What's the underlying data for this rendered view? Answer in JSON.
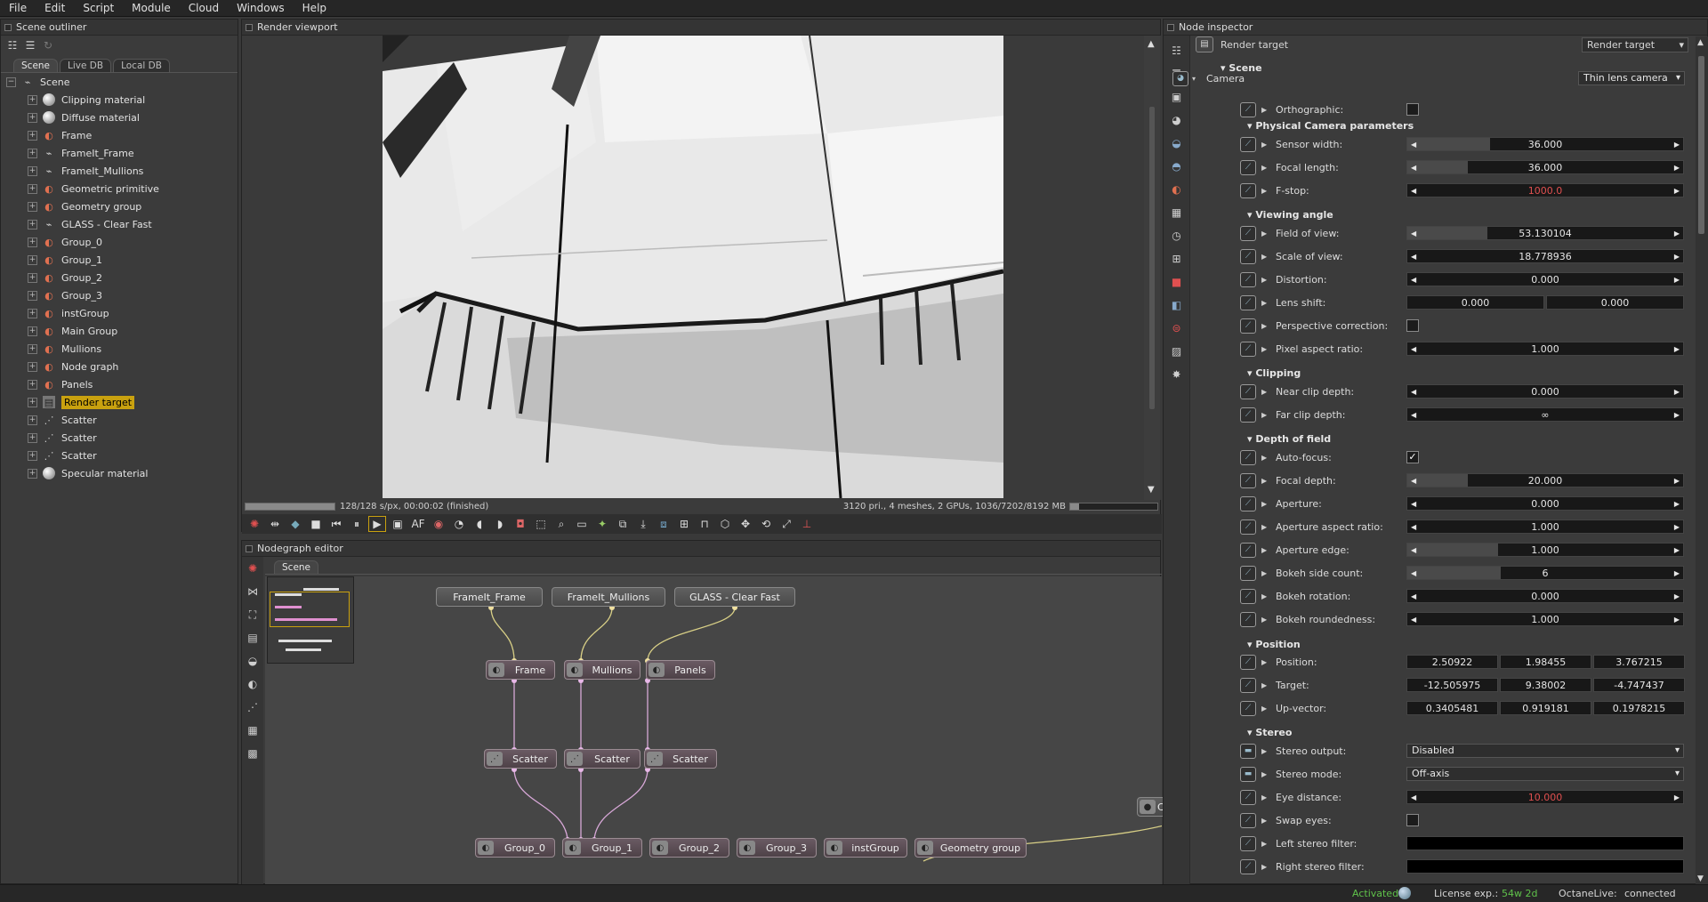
{
  "menu": [
    "File",
    "Edit",
    "Script",
    "Module",
    "Cloud",
    "Windows",
    "Help"
  ],
  "outliner": {
    "title": "Scene outliner",
    "tabs": [
      "Scene",
      "Live DB",
      "Local DB"
    ],
    "root": "Scene",
    "items": [
      {
        "label": "Clipping material",
        "icon": "material-sphere-icon"
      },
      {
        "label": "Diffuse material",
        "icon": "material-sphere-icon"
      },
      {
        "label": "Frame",
        "icon": "geometry-icon"
      },
      {
        "label": "FrameIt_Frame",
        "icon": "mesh-icon"
      },
      {
        "label": "FrameIt_Mullions",
        "icon": "mesh-icon"
      },
      {
        "label": "Geometric primitive",
        "icon": "geometry-icon"
      },
      {
        "label": "Geometry group",
        "icon": "geometry-icon"
      },
      {
        "label": "GLASS - Clear Fast",
        "icon": "mesh-icon"
      },
      {
        "label": "Group_0",
        "icon": "geometry-icon"
      },
      {
        "label": "Group_1",
        "icon": "geometry-icon"
      },
      {
        "label": "Group_2",
        "icon": "geometry-icon"
      },
      {
        "label": "Group_3",
        "icon": "geometry-icon"
      },
      {
        "label": "instGroup",
        "icon": "geometry-icon"
      },
      {
        "label": "Main Group",
        "icon": "geometry-icon"
      },
      {
        "label": "Mullions",
        "icon": "geometry-icon"
      },
      {
        "label": "Node graph",
        "icon": "geometry-icon"
      },
      {
        "label": "Panels",
        "icon": "geometry-icon"
      },
      {
        "label": "Render target",
        "icon": "render-target-icon"
      },
      {
        "label": "Scatter",
        "icon": "scatter-icon"
      },
      {
        "label": "Scatter",
        "icon": "scatter-icon"
      },
      {
        "label": "Scatter",
        "icon": "scatter-icon"
      },
      {
        "label": "Specular material",
        "icon": "material-sphere-icon"
      }
    ]
  },
  "viewport": {
    "title": "Render viewport",
    "progress": 1.0,
    "status_left": "128/128 s/px, 00:00:02 (finished)",
    "status_right": "3120 pri., 4 meshes, 2 GPUs, 1036/7202/8192 MB"
  },
  "nodegraph": {
    "title": "Nodegraph editor",
    "tab": "Scene",
    "nodes": {
      "frameit_frame": "FrameIt_Frame",
      "frameit_mullions": "FrameIt_Mullions",
      "glass": "GLASS - Clear Fast",
      "frame": "Frame",
      "mullions": "Mullions",
      "panels": "Panels",
      "scatter1": "Scatter",
      "scatter2": "Scatter",
      "scatter3": "Scatter",
      "group0": "Group_0",
      "group1": "Group_1",
      "group2": "Group_2",
      "group3": "Group_3",
      "instgroup": "instGroup",
      "geomgroup": "Geometry group",
      "clipping": "Clipping mate"
    }
  },
  "inspector": {
    "title": "Node inspector",
    "node_name": "Render target",
    "node_type": "Render target",
    "scene": "Scene",
    "camera": "Camera",
    "camera_type": "Thin lens camera",
    "orthographic": "Orthographic:",
    "sec_physical": "Physical Camera parameters",
    "sensor_width": {
      "label": "Sensor width:",
      "value": "36.000"
    },
    "focal_length": {
      "label": "Focal length:",
      "value": "36.000"
    },
    "fstop": {
      "label": "F-stop:",
      "value": "1000.0"
    },
    "sec_view": "Viewing angle",
    "fov": {
      "label": "Field of view:",
      "value": "53.130104"
    },
    "scale_view": {
      "label": "Scale of view:",
      "value": "18.778936"
    },
    "distortion": {
      "label": "Distortion:",
      "value": "0.000"
    },
    "lens_shift": {
      "label": "Lens shift:",
      "v1": "0.000",
      "v2": "0.000"
    },
    "persp_corr": "Perspective correction:",
    "pixel_aspect": {
      "label": "Pixel aspect ratio:",
      "value": "1.000"
    },
    "sec_clip": "Clipping",
    "near_clip": {
      "label": "Near clip depth:",
      "value": "0.000"
    },
    "far_clip": {
      "label": "Far clip depth:",
      "value": "∞"
    },
    "sec_dof": "Depth of field",
    "autofocus": "Auto-focus:",
    "focal_depth": {
      "label": "Focal depth:",
      "value": "20.000"
    },
    "aperture": {
      "label": "Aperture:",
      "value": "0.000"
    },
    "aperture_aspect": {
      "label": "Aperture aspect ratio:",
      "value": "1.000"
    },
    "aperture_edge": {
      "label": "Aperture edge:",
      "value": "1.000"
    },
    "bokeh_side": {
      "label": "Bokeh side count:",
      "value": "6"
    },
    "bokeh_rot": {
      "label": "Bokeh rotation:",
      "value": "0.000"
    },
    "bokeh_round": {
      "label": "Bokeh roundedness:",
      "value": "1.000"
    },
    "sec_pos": "Position",
    "position": {
      "label": "Position:",
      "v1": "2.50922",
      "v2": "1.98455",
      "v3": "3.767215"
    },
    "target": {
      "label": "Target:",
      "v1": "-12.505975",
      "v2": "9.38002",
      "v3": "-4.747437"
    },
    "upvector": {
      "label": "Up-vector:",
      "v1": "0.3405481",
      "v2": "0.919181",
      "v3": "0.1978215"
    },
    "sec_stereo": "Stereo",
    "stereo_output": {
      "label": "Stereo output:",
      "value": "Disabled"
    },
    "stereo_mode": {
      "label": "Stereo mode:",
      "value": "Off-axis"
    },
    "eye_distance": {
      "label": "Eye distance:",
      "value": "10.000"
    },
    "swap_eyes": "Swap eyes:",
    "left_filter": "Left stereo filter:",
    "right_filter": "Right stereo filter:"
  },
  "statusbar": {
    "activated": "Activated",
    "license_label": "License exp.:",
    "license_value": "54w 2d",
    "live_label": "OctaneLive:",
    "live_value": "connected"
  },
  "colors": {
    "selection": "#c9a10f",
    "accent_red": "#e05050",
    "activated_green": "#5fc24a"
  }
}
